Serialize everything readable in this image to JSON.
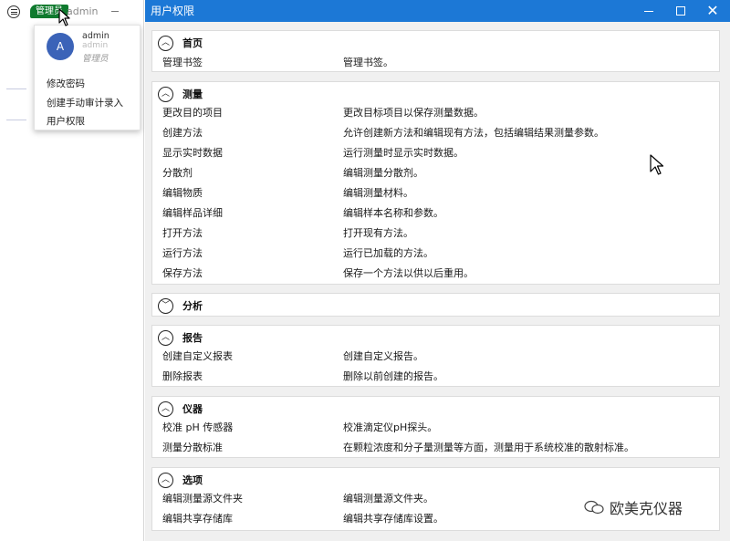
{
  "left": {
    "role_badge": "管理员",
    "user_name": "admin",
    "popup": {
      "avatar_letter": "A",
      "name": "admin",
      "sub": "admin",
      "role": "管理员",
      "menu": [
        "修改密码",
        "创建手动审计录入",
        "用户权限"
      ]
    }
  },
  "window": {
    "title": "用户权限",
    "sections": [
      {
        "title": "首页",
        "expanded": true,
        "rows": [
          {
            "perm": "管理书签",
            "desc": "管理书签。"
          }
        ]
      },
      {
        "title": "测量",
        "expanded": true,
        "rows": [
          {
            "perm": "更改目的项目",
            "desc": "更改目标项目以保存测量数据。"
          },
          {
            "perm": "创建方法",
            "desc": "允许创建新方法和编辑现有方法，包括编辑结果测量参数。"
          },
          {
            "perm": "显示实时数据",
            "desc": "运行测量时显示实时数据。"
          },
          {
            "perm": "分散剂",
            "desc": "编辑测量分散剂。"
          },
          {
            "perm": "编辑物质",
            "desc": "编辑测量材料。"
          },
          {
            "perm": "编辑样品详细",
            "desc": "编辑样本名称和参数。"
          },
          {
            "perm": "打开方法",
            "desc": "打开现有方法。"
          },
          {
            "perm": "运行方法",
            "desc": "运行已加载的方法。"
          },
          {
            "perm": "保存方法",
            "desc": "保存一个方法以供以后重用。"
          }
        ]
      },
      {
        "title": "分析",
        "expanded": false,
        "rows": []
      },
      {
        "title": "报告",
        "expanded": true,
        "rows": [
          {
            "perm": "创建自定义报表",
            "desc": "创建自定义报告。"
          },
          {
            "perm": "删除报表",
            "desc": "删除以前创建的报告。"
          }
        ]
      },
      {
        "title": "仪器",
        "expanded": true,
        "rows": [
          {
            "perm": "校准 pH 传感器",
            "desc": "校准滴定仪pH探头。"
          },
          {
            "perm": "测量分散标准",
            "desc": "在颗粒浓度和分子量测量等方面，测量用于系统校准的散射标准。"
          }
        ]
      },
      {
        "title": "选项",
        "expanded": true,
        "rows": [
          {
            "perm": "编辑测量源文件夹",
            "desc": "编辑测量源文件夹。"
          },
          {
            "perm": "编辑共享存储库",
            "desc": "编辑共享存储库设置。"
          }
        ]
      }
    ]
  },
  "watermark": "欧美克仪器",
  "colors": {
    "titlebar": "#1c78d6",
    "badge": "#0f7a2e",
    "avatar": "#3b63b8"
  }
}
